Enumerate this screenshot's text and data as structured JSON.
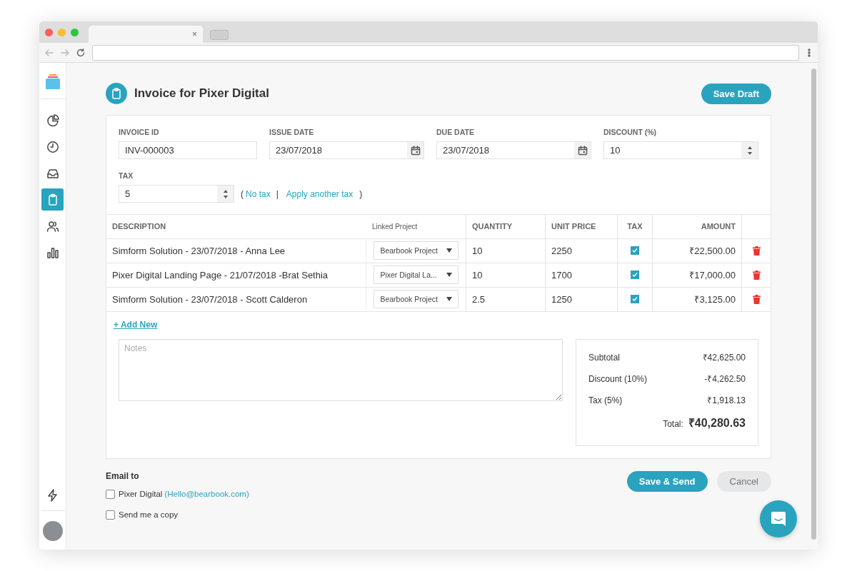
{
  "browser": {
    "tab_close": "×"
  },
  "sidebar": {
    "items": [
      {
        "kind": "pie",
        "selected": false
      },
      {
        "kind": "clock",
        "selected": false
      },
      {
        "kind": "inbox",
        "selected": false
      },
      {
        "kind": "clipboard",
        "selected": true
      },
      {
        "kind": "users",
        "selected": false
      },
      {
        "kind": "bars",
        "selected": false
      }
    ]
  },
  "header": {
    "title": "Invoice for Pixer Digital",
    "save_draft": "Save Draft"
  },
  "fields": [
    {
      "kind": "text",
      "label": "INVOICE ID",
      "value": "INV-000003"
    },
    {
      "kind": "date",
      "label": "ISSUE DATE",
      "value": "23/07/2018"
    },
    {
      "kind": "date",
      "label": "DUE DATE",
      "value": "23/07/2018"
    },
    {
      "kind": "number",
      "label": "DISCOUNT (%)",
      "value": "10"
    }
  ],
  "tax": {
    "label": "TAX",
    "value": "5",
    "open": "(",
    "no_tax": "No tax",
    "separator": "|",
    "apply": "Apply another tax",
    "close": ")"
  },
  "table": {
    "columns": [
      "DESCRIPTION",
      "Linked Project",
      "QUANTITY",
      "UNIT PRICE",
      "TAX",
      "AMOUNT"
    ],
    "rows": [
      {
        "description": "Simform Solution - 23/07/2018 - Anna Lee",
        "project": "Bearbook Project",
        "quantity": "10",
        "unit_price": "2250",
        "taxed": true,
        "amount": "₹22,500.00"
      },
      {
        "description": "Pixer Digital Landing Page - 21/07/2018 -Brat Sethia",
        "project": "Pixer Digital La...",
        "quantity": "10",
        "unit_price": "1700",
        "taxed": true,
        "amount": "₹17,000.00"
      },
      {
        "description": "Simform Solution - 23/07/2018 - Scott Calderon",
        "project": "Bearbook Project",
        "quantity": "2.5",
        "unit_price": "1250",
        "taxed": true,
        "amount": "₹3,125.00"
      }
    ]
  },
  "add_new": "+ Add New",
  "notes": {
    "placeholder": "Notes"
  },
  "summary": {
    "rows": [
      {
        "label": "Subtotal",
        "value": "₹42,625.00"
      },
      {
        "label": "Discount (10%)",
        "value": "-₹4,262.50"
      },
      {
        "label": "Tax (5%)",
        "value": "₹1,918.13"
      }
    ],
    "total_label": "Total:",
    "total_value": "₹40,280.63"
  },
  "email": {
    "title": "Email to",
    "options": [
      {
        "label": "Pixer Digital",
        "link": "(Hello@bearbook.com)",
        "checked": false
      },
      {
        "label": "Send me a copy",
        "checked": false
      }
    ]
  },
  "actions": {
    "send": "Save & Send",
    "cancel": "Cancel"
  }
}
